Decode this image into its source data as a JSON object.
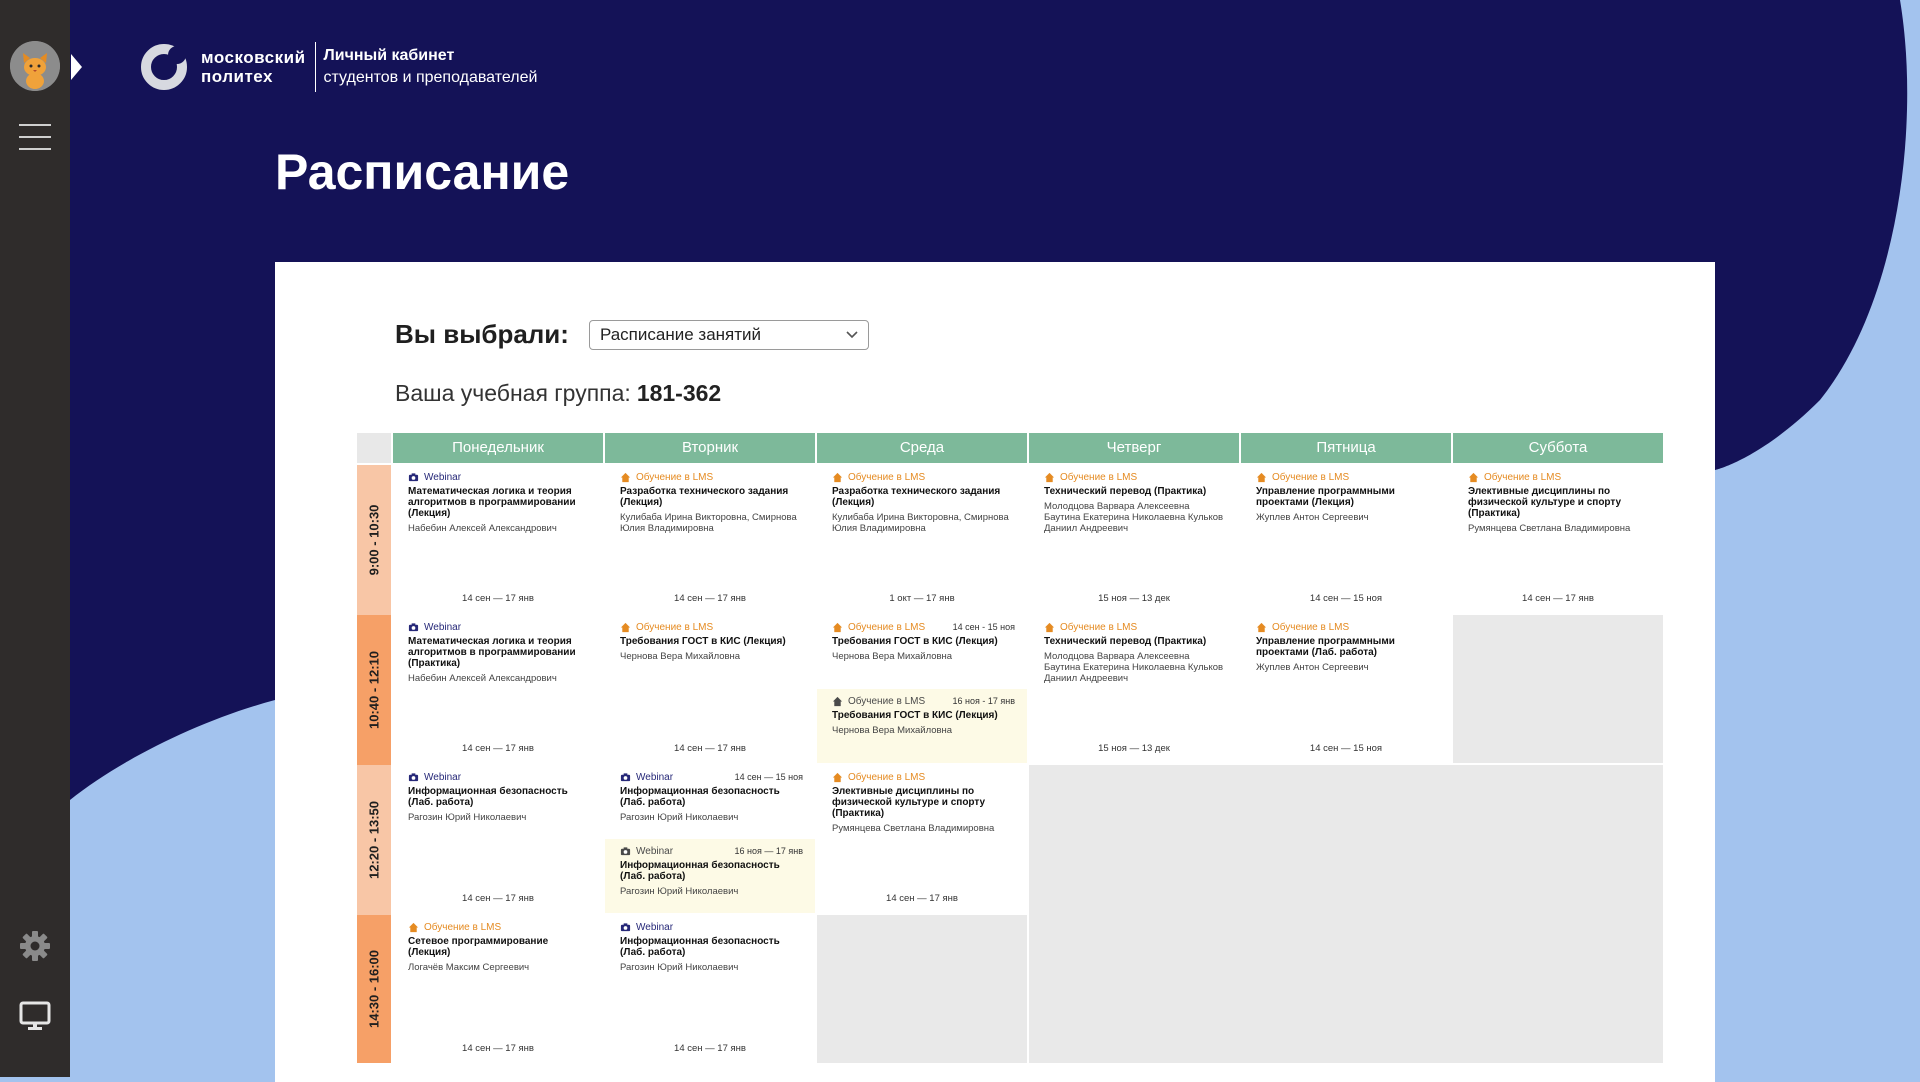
{
  "brand": {
    "wordmark_line1": "московский",
    "wordmark_line2": "политех",
    "cabinet_title": "Личный кабинет",
    "cabinet_subtitle": "студентов и преподавателей"
  },
  "colors": {
    "navy": "#141257",
    "sky": "#a3c3ee",
    "sidebar": "#2f2c2b",
    "header_green": "#7db99a",
    "webinar": "#262878",
    "lms": "#e58b22"
  },
  "sidebar": {
    "icons": [
      "cat-avatar-icon",
      "menu-icon",
      "gear-icon",
      "monitor-icon"
    ]
  },
  "page": {
    "title": "Расписание"
  },
  "selection": {
    "label": "Вы выбрали:",
    "value": "Расписание занятий"
  },
  "group": {
    "label": "Ваша учебная группа:",
    "value": "181-362"
  },
  "days": [
    "Понедельник",
    "Вторник",
    "Среда",
    "Четверг",
    "Пятница",
    "Суббота"
  ],
  "times": [
    "9:00 - 10:30",
    "10:40 - 12:10",
    "12:20 - 13:50",
    "14:30 - 16:00"
  ],
  "schedule": [
    {
      "day": 0,
      "slot": 0,
      "entries": [
        {
          "type": "webinar",
          "tag": "Webinar",
          "title": "Математическая логика и теория алгоритмов в программировании (Лекция)",
          "teacher": "Набебин Алексей Александрович"
        }
      ],
      "dates": "14 сен — 17 янв"
    },
    {
      "day": 1,
      "slot": 0,
      "entries": [
        {
          "type": "lms",
          "tag": "Обучение в LMS",
          "title": "Разработка технического задания (Лекция)",
          "teacher": "Кулибаба Ирина Викторовна, Смирнова Юлия Владимировна"
        }
      ],
      "dates": "14 сен — 17 янв"
    },
    {
      "day": 2,
      "slot": 0,
      "entries": [
        {
          "type": "lms",
          "tag": "Обучение в LMS",
          "title": "Разработка технического задания (Лекция)",
          "teacher": "Кулибаба Ирина Викторовна, Смирнова Юлия Владимировна"
        }
      ],
      "dates": "1 окт — 17 янв"
    },
    {
      "day": 3,
      "slot": 0,
      "entries": [
        {
          "type": "lms",
          "tag": "Обучение в LMS",
          "title": "Технический перевод (Практика)",
          "teacher": "Молодцова Варвара Алексеевна Баутина Екатерина Николаевна Кульков Даниил Андреевич"
        }
      ],
      "dates": "15 ноя — 13 дек"
    },
    {
      "day": 4,
      "slot": 0,
      "entries": [
        {
          "type": "lms",
          "tag": "Обучение в LMS",
          "title": "Управление программными проектами (Лекция)",
          "teacher": "Жуплев Антон Сергеевич"
        }
      ],
      "dates": "14 сен — 15 ноя"
    },
    {
      "day": 5,
      "slot": 0,
      "entries": [
        {
          "type": "lms",
          "tag": "Обучение в LMS",
          "title": "Элективные дисциплины по физической культуре и спорту (Практика)",
          "teacher": "Румянцева Светлана Владимировна"
        }
      ],
      "dates": "14 сен — 17 янв"
    },
    {
      "day": 0,
      "slot": 1,
      "entries": [
        {
          "type": "webinar",
          "tag": "Webinar",
          "title": "Математическая логика и теория алгоритмов в программировании (Практика)",
          "teacher": "Набебин Алексей Александрович"
        }
      ],
      "dates": "14 сен — 17 янв"
    },
    {
      "day": 1,
      "slot": 1,
      "entries": [
        {
          "type": "lms",
          "tag": "Обучение в LMS",
          "title": "Требования ГОСТ в КИС (Лекция)",
          "teacher": "Чернова Вера Михайловна"
        }
      ],
      "dates": "14 сен — 17 янв"
    },
    {
      "day": 2,
      "slot": 1,
      "entries": [
        {
          "type": "lms",
          "tag": "Обучение в LMS",
          "range": "14 сен - 15 ноя",
          "title": "Требования ГОСТ в КИС (Лекция)",
          "teacher": "Чернова Вера Михайловна"
        },
        {
          "type": "gray",
          "tag": "Обучение в LMS",
          "range": "16 ноя - 17 янв",
          "title": "Требования ГОСТ в КИС (Лекция)",
          "teacher": "Чернова Вера Михайловна"
        }
      ],
      "dates": ""
    },
    {
      "day": 3,
      "slot": 1,
      "entries": [
        {
          "type": "lms",
          "tag": "Обучение в LMS",
          "title": "Технический перевод (Практика)",
          "teacher": "Молодцова Варвара Алексеевна Баутина Екатерина Николаевна Кульков Даниил Андреевич"
        }
      ],
      "dates": "15 ноя — 13 дек"
    },
    {
      "day": 4,
      "slot": 1,
      "entries": [
        {
          "type": "lms",
          "tag": "Обучение в LMS",
          "title": "Управление программными проектами (Лаб. работа)",
          "teacher": "Жуплев Антон Сергеевич"
        }
      ],
      "dates": "14 сен — 15 ноя"
    },
    {
      "day": 0,
      "slot": 2,
      "entries": [
        {
          "type": "webinar",
          "tag": "Webinar",
          "title": "Информационная безопасность (Лаб. работа)",
          "teacher": "Рагозин Юрий Николаевич"
        }
      ],
      "dates": "14 сен — 17 янв"
    },
    {
      "day": 1,
      "slot": 2,
      "entries": [
        {
          "type": "webinar",
          "tag": "Webinar",
          "range": "14 сен — 15 ноя",
          "title": "Информационная безопасность (Лаб. работа)",
          "teacher": "Рагозин Юрий Николаевич"
        },
        {
          "type": "gray",
          "tag": "Webinar",
          "range": "16 ноя — 17 янв",
          "title": "Информационная безопасность (Лаб. работа)",
          "teacher": "Рагозин Юрий Николаевич"
        }
      ],
      "dates": ""
    },
    {
      "day": 2,
      "slot": 2,
      "entries": [
        {
          "type": "lms",
          "tag": "Обучение в LMS",
          "title": "Элективные дисциплины по физической культуре и спорту (Практика)",
          "teacher": "Румянцева Светлана Владимировна"
        }
      ],
      "dates": "14 сен — 17 янв"
    },
    {
      "day": 0,
      "slot": 3,
      "entries": [
        {
          "type": "lms",
          "tag": "Обучение в LMS",
          "title": "Сетевое программирование (Лекция)",
          "teacher": "Логачёв Максим Сергеевич"
        }
      ],
      "dates": "14 сен — 17 янв"
    },
    {
      "day": 1,
      "slot": 3,
      "entries": [
        {
          "type": "webinar",
          "tag": "Webinar",
          "title": "Информационная безопасность (Лаб. работа)",
          "teacher": "Рагозин Юрий Николаевич"
        }
      ],
      "dates": "14 сен — 17 янв"
    }
  ]
}
